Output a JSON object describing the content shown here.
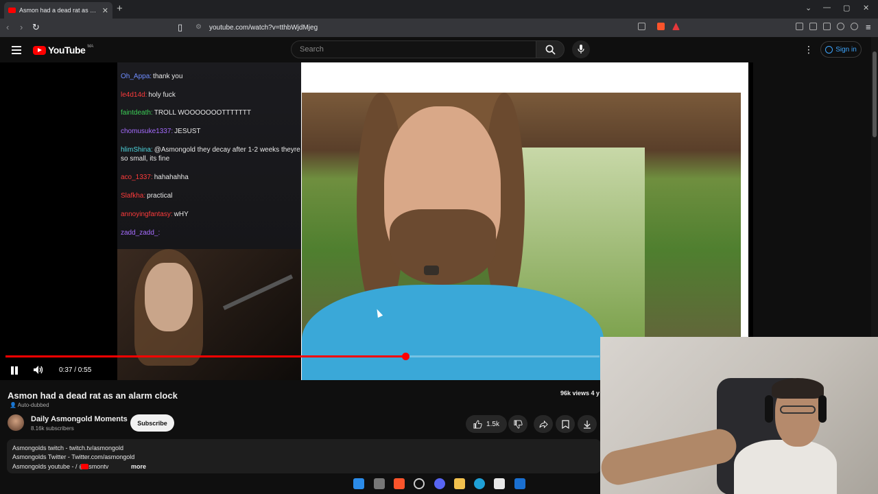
{
  "browser": {
    "tab_title": "Asmon had a dead rat as an a",
    "url": "youtube.com/watch?v=tthbWjdMjeg"
  },
  "youtube": {
    "logo_text": "YouTube",
    "region_code": "MA",
    "search_placeholder": "Search",
    "sign_in_label": "Sign in"
  },
  "chat": [
    {
      "user": "Oh_Appa:",
      "text": "thank you",
      "color": "#6f8dff"
    },
    {
      "user": "le4d14d:",
      "text": "holy fuck",
      "color": "#ff3b3b"
    },
    {
      "user": "faintdeath:",
      "text": "TROLL WOOOOOOOTTTTTTT",
      "color": "#3ccf55"
    },
    {
      "user": "chomusuke1337:",
      "text": "JESUST",
      "color": "#a66cff"
    },
    {
      "user": "hlimShina:",
      "text": "@Asmongold they decay after 1-2 weeks theyre so small, its fine",
      "color": "#4fd8e0"
    },
    {
      "user": "aco_1337:",
      "text": "hahahahha",
      "color": "#ff3b3b"
    },
    {
      "user": "Slafkha:",
      "text": "practical",
      "color": "#ff3b3b"
    },
    {
      "user": "annoyingfantasy:",
      "text": "wHY",
      "color": "#ff3b3b"
    },
    {
      "user": "zadd_zadd_:",
      "text": "",
      "color": "#a66cff"
    }
  ],
  "player": {
    "time": "0:37 / 0:55",
    "progress_fraction": 0.6727
  },
  "video": {
    "title": "Asmon had a dead rat as an alarm clock",
    "auto_dubbed": "Auto-dubbed",
    "views": "96k views  4 y",
    "channel": "Daily Asmongold Moments",
    "subscribers": "8.16k subscribers",
    "subscribe_label": "Subscribe",
    "likes": "1.5k",
    "description": [
      "Asmongolds twitch - twitch.tv/asmongold",
      "Asmongolds Twitter - Twitter.com/asmongold",
      "Asmongolds youtube -  / @asmontv"
    ],
    "more_label": "more"
  }
}
